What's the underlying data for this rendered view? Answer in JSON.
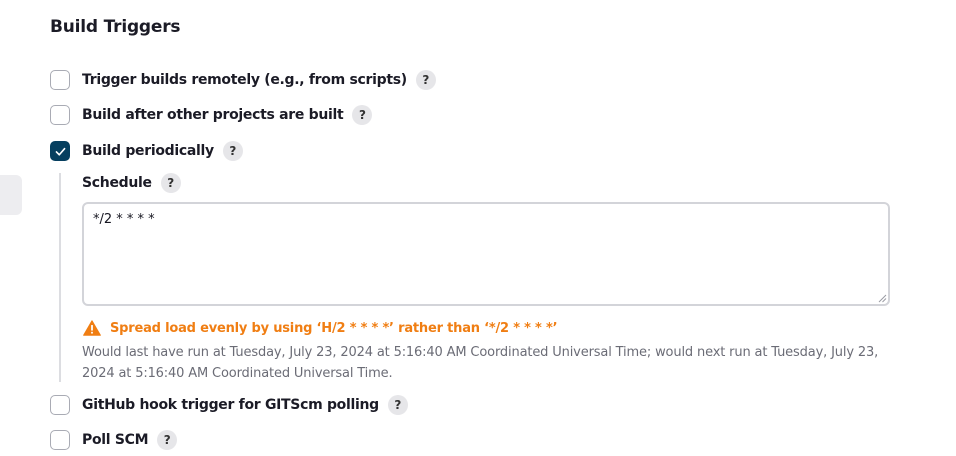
{
  "section": {
    "title": "Build Triggers"
  },
  "triggers": [
    {
      "label": "Trigger builds remotely (e.g., from scripts)",
      "checked": false,
      "help": "?"
    },
    {
      "label": "Build after other projects are built",
      "checked": false,
      "help": "?"
    },
    {
      "label": "Build periodically",
      "checked": true,
      "help": "?"
    },
    {
      "label": "GitHub hook trigger for GITScm polling",
      "checked": false,
      "help": "?"
    },
    {
      "label": "Poll SCM",
      "checked": false,
      "help": "?"
    }
  ],
  "schedule": {
    "label": "Schedule",
    "help": "?",
    "value": "*/2 * * * *",
    "warning": "Spread load evenly by using ‘H/2 * * * *’ rather than ‘*/2 * * * *’",
    "run_info": "Would last have run at Tuesday, July 23, 2024 at 5:16:40 AM Coordinated Universal Time; would next run at Tuesday, July 23, 2024 at 5:16:40 AM Coordinated Universal Time."
  },
  "colors": {
    "checkbox_checked": "#063f5f",
    "warning": "#f07e13",
    "muted_text": "#6b6c76"
  },
  "icons": {
    "checkmark": "check-icon",
    "warning": "warning-triangle-icon",
    "help": "help-icon"
  }
}
